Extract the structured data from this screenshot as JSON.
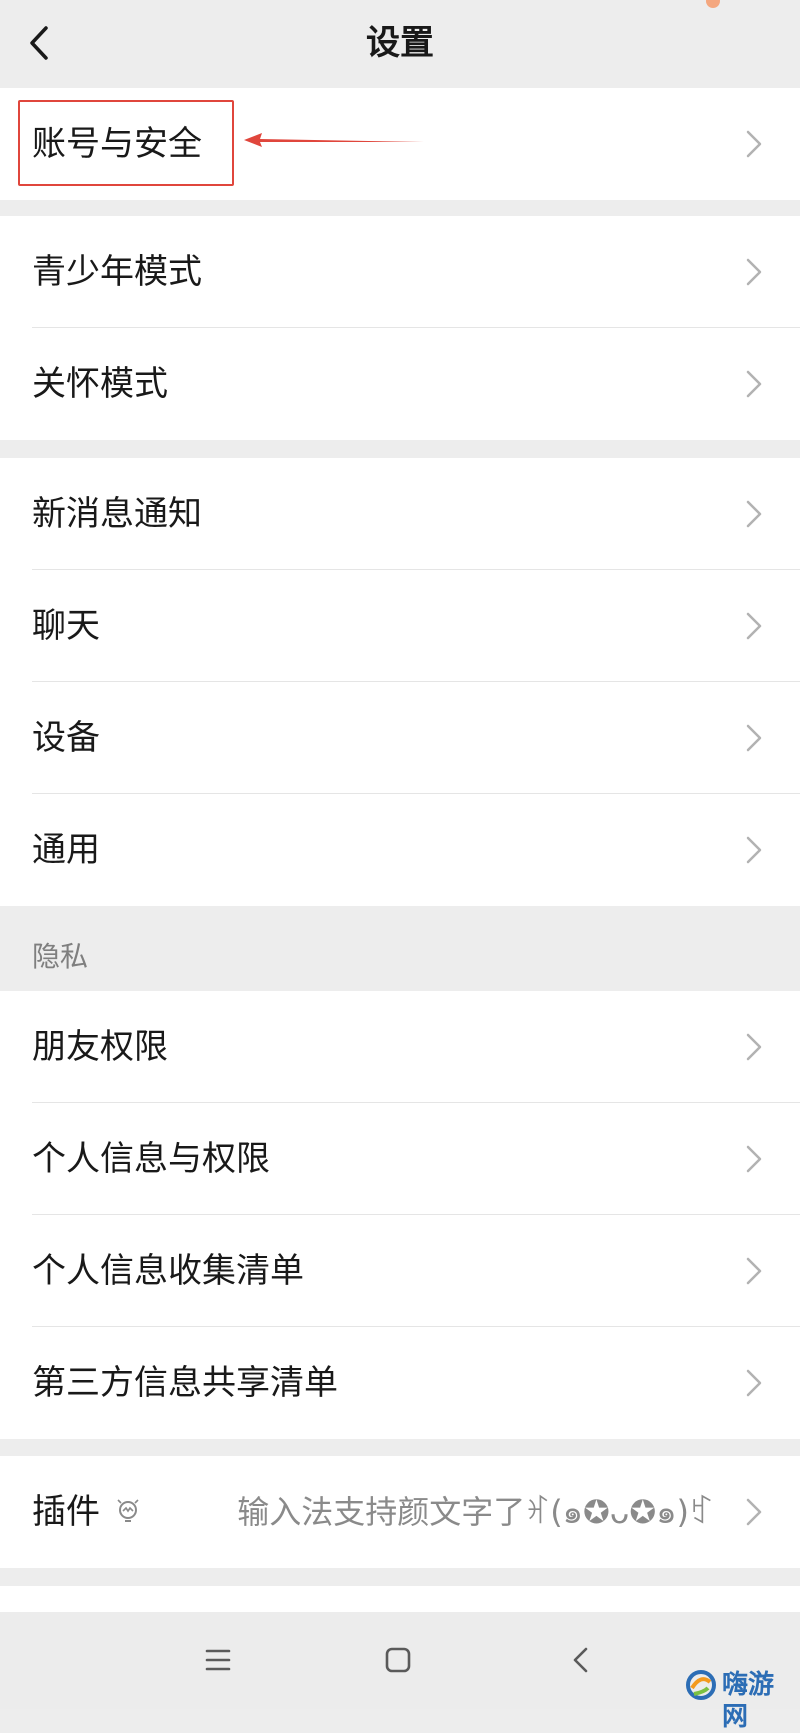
{
  "header": {
    "title": "设置"
  },
  "group1": [
    {
      "label": "账号与安全"
    }
  ],
  "group2": [
    {
      "label": "青少年模式"
    },
    {
      "label": "关怀模式"
    }
  ],
  "group3": [
    {
      "label": "新消息通知"
    },
    {
      "label": "聊天"
    },
    {
      "label": "设备"
    },
    {
      "label": "通用"
    }
  ],
  "privacy": {
    "section_title": "隐私",
    "items": [
      {
        "label": "朋友权限"
      },
      {
        "label": "个人信息与权限"
      },
      {
        "label": "个人信息收集清单"
      },
      {
        "label": "第三方信息共享清单"
      }
    ]
  },
  "plugin": {
    "label": "插件",
    "value": "输入法支持颜文字了ꂛ(๑✪ᴗ✪๑)ꃏ"
  },
  "watermark": {
    "text": "嗨游网"
  },
  "colors": {
    "accent_red": "#e0463c",
    "background": "#ededed",
    "card": "#ffffff",
    "watermark_blue": "#2c6db5"
  }
}
